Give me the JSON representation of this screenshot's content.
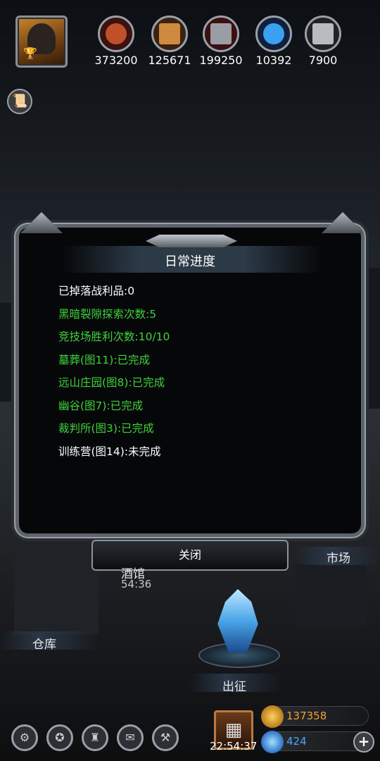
{
  "resources": [
    {
      "icon": "meat-icon",
      "value": "373200",
      "color": "#c0502a"
    },
    {
      "icon": "wood-planks-icon",
      "value": "125671",
      "color": "#d08a40"
    },
    {
      "icon": "iron-ingot-icon",
      "value": "199250",
      "color": "#9a9ea4"
    },
    {
      "icon": "blue-crystal-icon",
      "value": "10392",
      "color": "#3aa0f0"
    },
    {
      "icon": "steel-ingot-icon",
      "value": "7900",
      "color": "#b8bcc2"
    }
  ],
  "dialog": {
    "title": "日常进度",
    "lines": [
      {
        "text": "已掉落战利品:0",
        "status": "white"
      },
      {
        "text": "黑暗裂隙探索次数:5",
        "status": "green"
      },
      {
        "text": "竞技场胜利次数:10/10",
        "status": "green"
      },
      {
        "text": "墓葬(图11):已完成",
        "status": "green"
      },
      {
        "text": "远山庄园(图8):已完成",
        "status": "green"
      },
      {
        "text": "幽谷(图7):已完成",
        "status": "green"
      },
      {
        "text": "裁判所(图3):已完成",
        "status": "green"
      },
      {
        "text": "训练营(图14):未完成",
        "status": "white"
      }
    ],
    "close_label": "关闭"
  },
  "town": {
    "market": "市场",
    "tavern": "酒馆",
    "tavern_timer": "54:36",
    "warehouse": "仓库",
    "expedition": "出征"
  },
  "bottom": {
    "clock": "22:54:37",
    "gold": "137358",
    "gems": "424",
    "plus": "+"
  },
  "colors": {
    "completed": "#3fd23a",
    "normal": "#ffffff",
    "gold_text": "#f0a030",
    "gem_text": "#4aa8ff"
  }
}
